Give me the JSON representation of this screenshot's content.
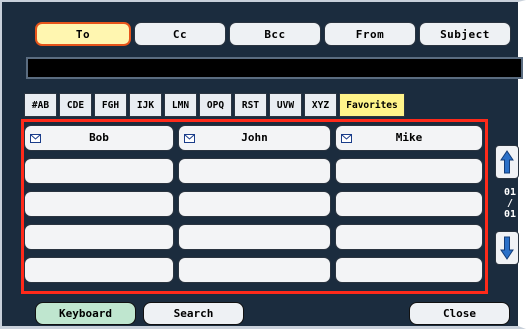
{
  "field_tabs": [
    {
      "label": "To",
      "active": true
    },
    {
      "label": "Cc",
      "active": false
    },
    {
      "label": "Bcc",
      "active": false
    },
    {
      "label": "From",
      "active": false
    },
    {
      "label": "Subject",
      "active": false
    }
  ],
  "address_bar": {
    "value": ""
  },
  "index_tabs": [
    "#AB",
    "CDE",
    "FGH",
    "IJK",
    "LMN",
    "OPQ",
    "RST",
    "UVW",
    "XYZ",
    "Favorites"
  ],
  "active_index_tab": "Favorites",
  "contacts": [
    {
      "name": "Bob",
      "icon": "envelope-icon"
    },
    {
      "name": "John",
      "icon": "envelope-icon"
    },
    {
      "name": "Mike",
      "icon": "envelope-icon"
    }
  ],
  "pager": {
    "current": "01",
    "separator": "/",
    "total": "01"
  },
  "bottom_buttons": {
    "keyboard": "Keyboard",
    "search": "Search",
    "close": "Close"
  },
  "colors": {
    "panel_bg": "#1b2c3e",
    "highlight_border": "#ff2a1a",
    "active_field_tab": "#fff6b0",
    "active_index_tab": "#fff48a",
    "keyboard_button": "#bfe6cf",
    "arrow_icon": "#2a70c8"
  }
}
